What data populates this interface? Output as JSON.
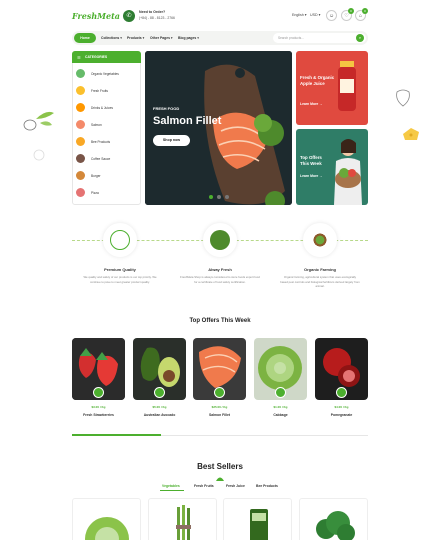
{
  "header": {
    "logo": "FreshMeta",
    "order_label": "Need to Order?",
    "order_phone": "(+84) - 88 - 8123 - 2766",
    "language": "English",
    "currency": "USD",
    "wishlist_count": "0",
    "cart_count": "0"
  },
  "nav": {
    "items": [
      "Home",
      "Collections",
      "Products",
      "Other Pages",
      "Blog pages"
    ],
    "search_placeholder": "Search products..."
  },
  "categories": {
    "title": "CATEGORIES",
    "items": [
      "Organic Vegetables",
      "Fresh Fruits",
      "Drinks & Juices",
      "Salmon",
      "Bee Products",
      "Coffee Sauce",
      "Burger",
      "Pizza"
    ]
  },
  "hero": {
    "subtitle": "FRESH FOOD",
    "title": "Salmon Fillet",
    "button": "Shop now",
    "slides": 3,
    "active_slide": 1
  },
  "promos": [
    {
      "title": "Fresh & Organic Apple Juice",
      "link": "Learn More →"
    },
    {
      "title": "Top Offers This Week",
      "link": "Learn More →"
    }
  ],
  "features": [
    {
      "title": "Premium Quality",
      "desc": "We quality and safety of our products is our top priority. We continue to pave to meet greater product quality."
    },
    {
      "title": "Alway Fresh",
      "desc": "FreshMeta Shop is always considered to store foods export food for a certificate of food safety certification."
    },
    {
      "title": "Organic Farming",
      "desc": "Organic farming, agricultural system that uses ecologically based pest controls and biological fertilizers derived largely from animal."
    }
  ],
  "offers": {
    "title": "Top Offers This Week",
    "items": [
      {
        "name": "Fresh Strawberries",
        "price": "$3.00 / Kg"
      },
      {
        "name": "Australian Avocado",
        "price": "$5.00 / Kg"
      },
      {
        "name": "Salmon Fillet",
        "price": "$25.00 / Kg"
      },
      {
        "name": "Cabbage",
        "price": "$1.00 / Kg"
      },
      {
        "name": "Pomegranate",
        "price": "$4.00 / Kg"
      }
    ],
    "progress": 0.3
  },
  "best_sellers": {
    "title": "Best Sellers",
    "tabs": [
      "Vegetables",
      "Fresh Fruits",
      "Fresh Juice",
      "Bee Products"
    ]
  },
  "colors": {
    "accent": "#4caf2e",
    "dark_green": "#2e7d32",
    "promo_red": "#e04a3f",
    "promo_teal": "#2f7d67"
  }
}
